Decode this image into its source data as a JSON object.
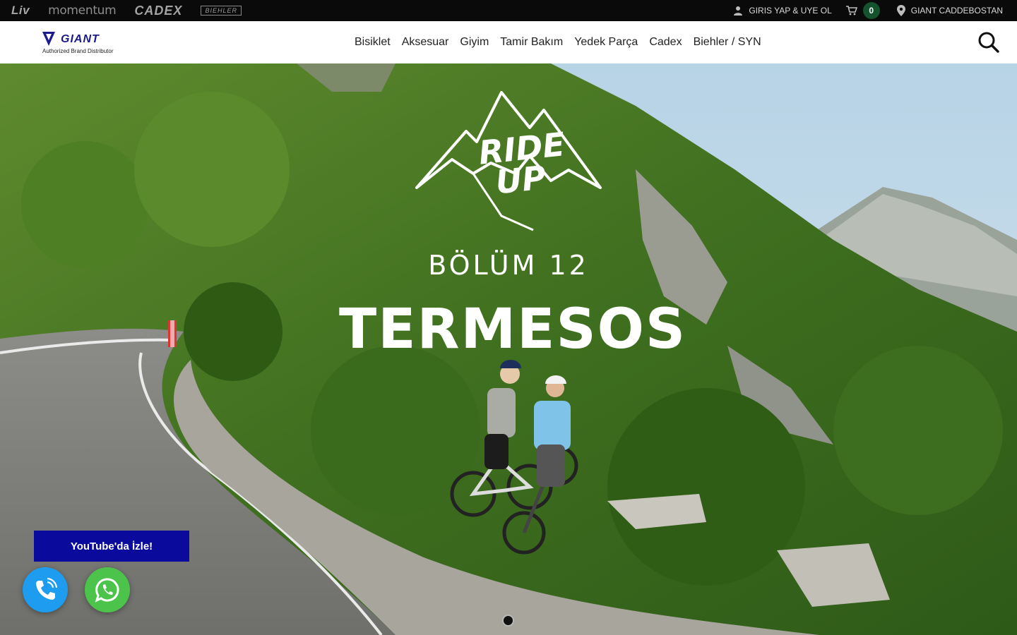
{
  "topbar": {
    "brands": [
      "Liv",
      "momentum",
      "CADEX",
      "BIEHLER"
    ],
    "login_label": "GIRIS YAP & UYE OL",
    "cart_count": "0",
    "store_label": "GIANT CADDEBOSTAN"
  },
  "header": {
    "logo_text": "GIANT",
    "logo_subtitle": "Authorized Brand Distributor",
    "nav": [
      "Bisiklet",
      "Aksesuar",
      "Giyim",
      "Tamir Bakım",
      "Yedek Parça",
      "Cadex",
      "Biehler / SYN"
    ]
  },
  "hero": {
    "badge_line1": "RIDE",
    "badge_line2": "UP",
    "episode": "BÖLÜM 12",
    "title": "TERMESOS",
    "cta_label": "YouTube'da İzle!",
    "slide_active": 1,
    "slide_total": 1
  },
  "colors": {
    "accent": "#0a0a9c",
    "cart_badge": "#14532d",
    "call_button": "#1e9cf0",
    "whatsapp_button": "#4cc44b"
  },
  "icons": {
    "login": "user-icon",
    "cart": "cart-icon",
    "store": "location-pin-icon",
    "search": "search-icon",
    "call": "phone-icon",
    "whatsapp": "whatsapp-icon"
  }
}
